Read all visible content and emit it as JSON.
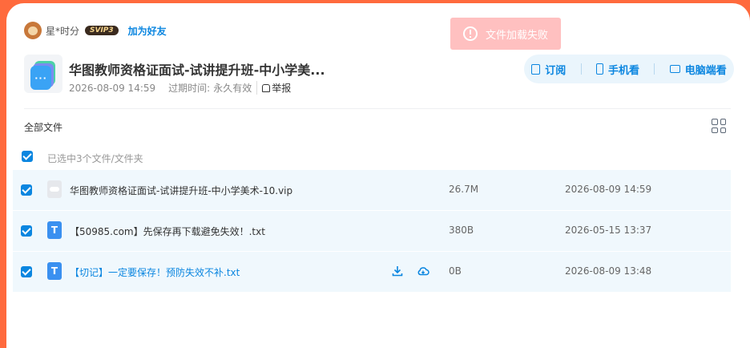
{
  "user": {
    "name": "星*时分",
    "vip_badge": "SVIP3",
    "add_friend": "加为好友"
  },
  "toast": {
    "text": "文件加载失败"
  },
  "share": {
    "icon_text": "···",
    "title": "华图教师资格证面试-试讲提升班-中小学美...",
    "date": "2026-08-09 14:59",
    "expire_label": "过期时间:",
    "expire_value": "永久有效",
    "report": "举报"
  },
  "actions": {
    "subscribe": "订阅",
    "mobile": "手机看",
    "pc": "电脑端看"
  },
  "files_header": {
    "all_files": "全部文件",
    "selected_info": "已选中3个文件/文件夹"
  },
  "files": [
    {
      "icon": "cloud-file-icon",
      "name": "华图教师资格证面试-试讲提升班-中小学美术-10.vip",
      "size": "26.7M",
      "date": "2026-08-09 14:59"
    },
    {
      "icon": "txt-file-icon",
      "icon_text": "T",
      "name": "【50985.com】先保存再下载避免失效！.txt",
      "size": "380B",
      "date": "2026-05-15 13:37"
    },
    {
      "icon": "txt-file-icon",
      "icon_text": "T",
      "name": "【切记】一定要保存！预防失效不补.txt",
      "size": "0B",
      "date": "2026-08-09 13:48"
    }
  ],
  "colors": {
    "accent": "#0b86e0",
    "frame": "#ff6a3d",
    "toast_bg": "#ffc0c0",
    "row_bg": "#f0f8fd"
  }
}
